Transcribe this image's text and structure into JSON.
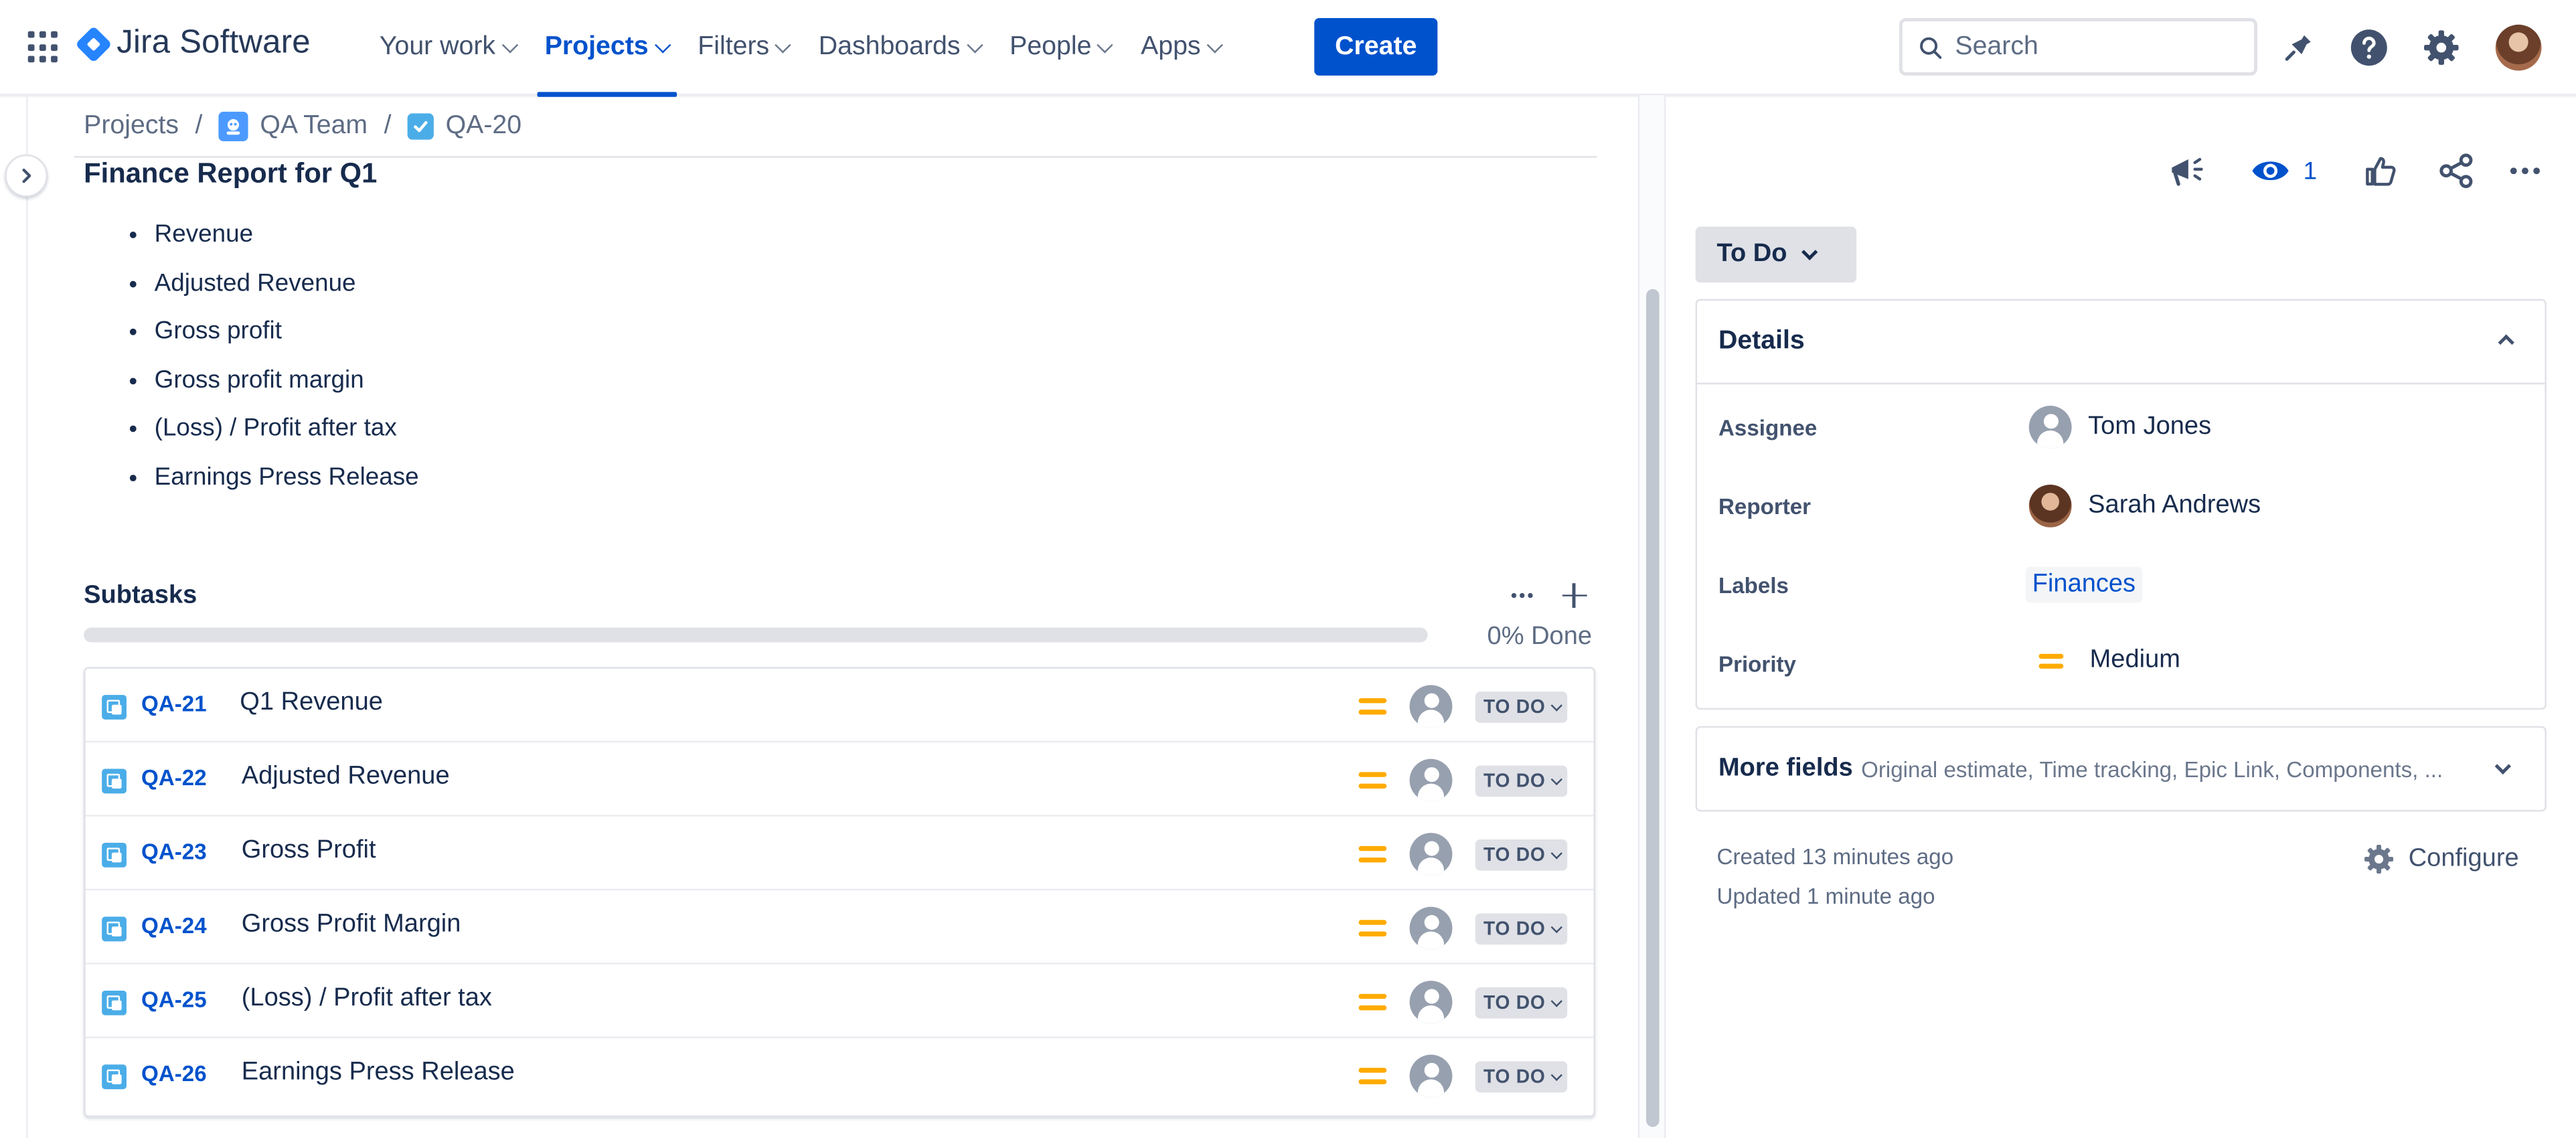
{
  "nav": {
    "product": "Jira Software",
    "items": [
      {
        "label": "Your work"
      },
      {
        "label": "Projects"
      },
      {
        "label": "Filters"
      },
      {
        "label": "Dashboards"
      },
      {
        "label": "People"
      },
      {
        "label": "Apps"
      }
    ],
    "create_label": "Create",
    "search_placeholder": "Search"
  },
  "breadcrumb": {
    "root": "Projects",
    "project": "QA Team",
    "issue": "QA-20",
    "separator": "/"
  },
  "issue": {
    "title": "Finance Report for Q1",
    "description_items": [
      "Revenue",
      "Adjusted Revenue",
      "Gross profit",
      "Gross profit margin",
      "(Loss) / Profit after tax",
      "Earnings Press Release"
    ]
  },
  "subtasks": {
    "title": "Subtasks",
    "progress_label": "0% Done",
    "progress_fraction": 0,
    "rows": [
      {
        "key": "QA-21",
        "summary": "Q1 Revenue",
        "status": "TO DO"
      },
      {
        "key": "QA-22",
        "summary": "Adjusted Revenue",
        "status": "TO DO"
      },
      {
        "key": "QA-23",
        "summary": "Gross Profit",
        "status": "TO DO"
      },
      {
        "key": "QA-24",
        "summary": "Gross Profit Margin",
        "status": "TO DO"
      },
      {
        "key": "QA-25",
        "summary": "(Loss) / Profit after tax",
        "status": "TO DO"
      },
      {
        "key": "QA-26",
        "summary": "Earnings Press Release",
        "status": "TO DO"
      }
    ]
  },
  "sidebar": {
    "watch_count": "1",
    "status_button": "To Do",
    "details_title": "Details",
    "fields": {
      "assignee_label": "Assignee",
      "assignee_value": "Tom Jones",
      "reporter_label": "Reporter",
      "reporter_value": "Sarah Andrews",
      "labels_label": "Labels",
      "labels_value": "Finances",
      "priority_label": "Priority",
      "priority_value": "Medium"
    },
    "more_fields_title": "More fields",
    "more_fields_sub": "Original estimate, Time tracking, Epic Link, Components, ...",
    "created": "Created 13 minutes ago",
    "updated": "Updated 1 minute ago",
    "configure": "Configure"
  },
  "colors": {
    "brand": "#0052cc",
    "priority_medium": "#ffab00",
    "issue_icon": "#4bade8"
  }
}
